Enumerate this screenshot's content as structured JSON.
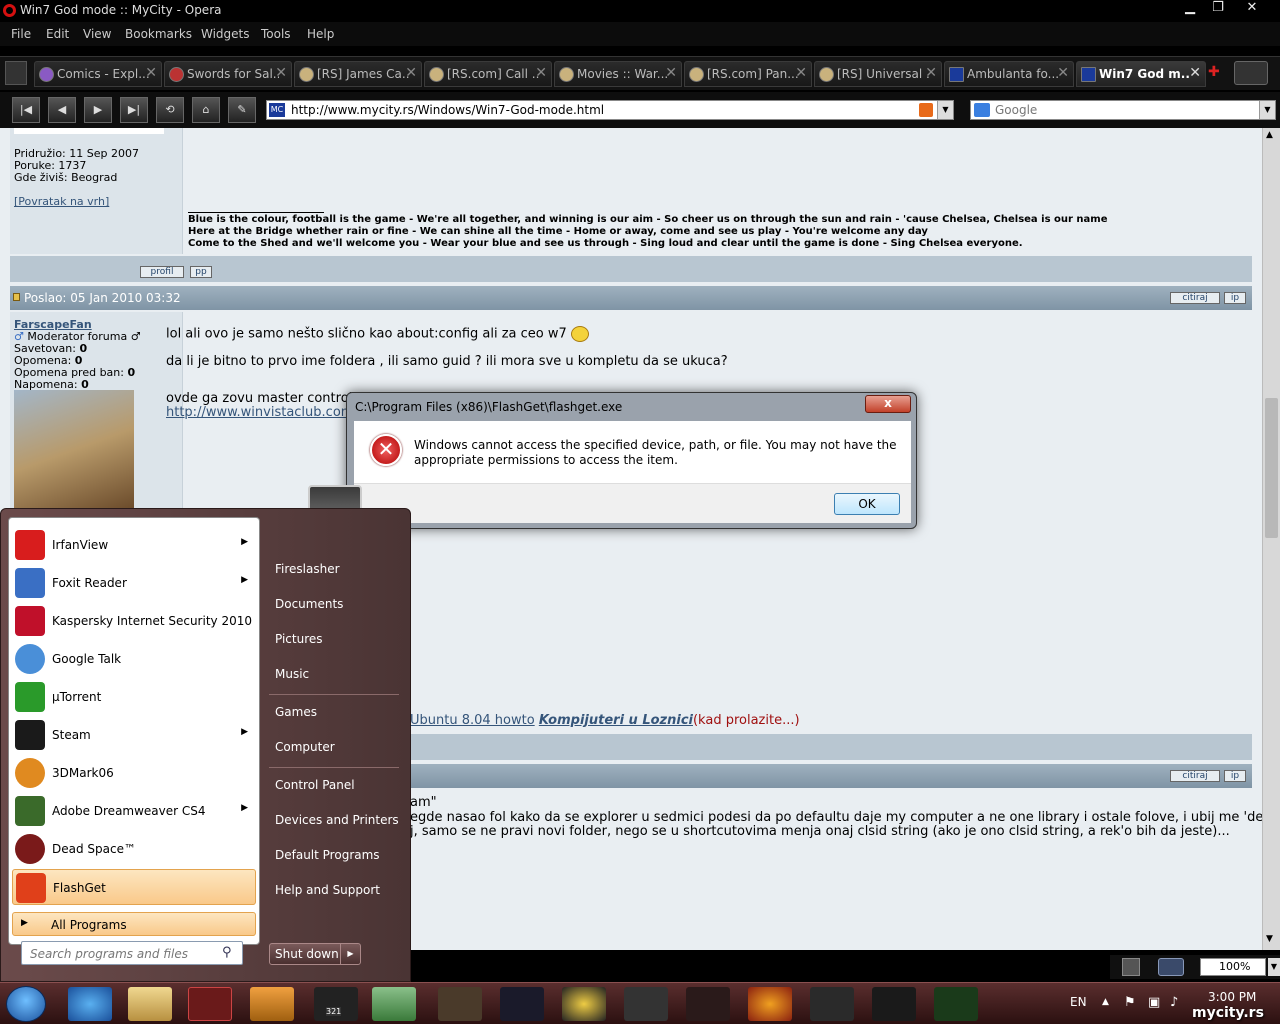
{
  "window": {
    "title": "Win7 God mode :: MyCity - Opera",
    "min": "▁",
    "max": "❐",
    "close": "✕"
  },
  "menu": [
    "File",
    "Edit",
    "View",
    "Bookmarks",
    "Widgets",
    "Tools",
    "Help"
  ],
  "tabs": [
    {
      "label": "Comics - Expl..."
    },
    {
      "label": "Swords for Sal..."
    },
    {
      "label": "[RS] James Ca..."
    },
    {
      "label": "[RS.com] Call ..."
    },
    {
      "label": "Movies :: War..."
    },
    {
      "label": "[RS.com] Pan..."
    },
    {
      "label": "[RS] Universal ..."
    },
    {
      "label": "Ambulanta fo..."
    },
    {
      "label": "Win7 God m..."
    }
  ],
  "nav": {
    "url": "http://www.mycity.rs/Windows/Win7-God-mode.html",
    "search_placeholder": "Google",
    "favicon": "MC"
  },
  "post1": {
    "joined": "Pridružio: 11 Sep 2007",
    "posts": "Poruke: 1737",
    "location": "Gde živiš: Beograd",
    "back_top": "[Povratak na vrh]",
    "sig": [
      "Blue is the colour, football is the game - We're all together, and winning is our aim - So cheer us on through the sun and rain - 'cause Chelsea, Chelsea is our name",
      "Here at the Bridge whether rain or fine - We can shine all the time - Home or away, come and see us play - You're welcome any day",
      "Come to the Shed and we'll welcome you - Wear your blue and see us through - Sing loud and clear until the game is done - Sing Chelsea everyone."
    ],
    "profil": "profil",
    "pp": "pp"
  },
  "post2": {
    "header": "Poslao: 05 Jan 2010 03:32",
    "quote": "citiraj",
    "ip": "ip",
    "user": "FarscapeFan",
    "role": "Moderator foruma ♂",
    "stats": [
      {
        "label": "Savetovan:",
        "value": "0"
      },
      {
        "label": "Opomena:",
        "value": "0"
      },
      {
        "label": "Opomena pred ban:",
        "value": "0"
      },
      {
        "label": "Napomena:",
        "value": "0"
      }
    ],
    "line1": "lol ali ovo je samo nešto slično kao about:config ali za ceo w7",
    "line2": "da li je bitno to prvo ime foldera , ili samo guid ? ili mora sve u kompletu da se ukuca?",
    "line3": "ovde ga zovu master control",
    "link": "http://www.winvistaclub.com",
    "sig_link1": "Ubuntu 8.04 howto",
    "sig_link2": "Kompijuteri u Loznici",
    "sig_tail": "(kad prolazite...)"
  },
  "post3": {
    "quote": "citiraj",
    "ip": "ip",
    "q_tail": "am\"",
    "l1": "egde nasao fol kako da se explorer u sedmici podesi da po defaultu daje my computer a ne one library i ostale folove, i ubij me 'de je",
    "l2": "j, samo se ne pravi novi folder, nego se u shortcutovima menja onaj clsid string (ako je ono clsid string, a rek'o bih da jeste)..."
  },
  "dialog": {
    "title": "C:\\Program Files (x86)\\FlashGet\\flashget.exe",
    "close": "x",
    "message": "Windows cannot access the specified device, path, or file.  You may not have the appropriate permissions to access the item.",
    "ok": "OK",
    "icon": "error-icon"
  },
  "startmenu": {
    "programs": [
      {
        "label": "IrfanView",
        "arrow": "▶",
        "color": "#d81d1d"
      },
      {
        "label": "Foxit Reader",
        "arrow": "▶",
        "color": "#3a6fc4"
      },
      {
        "label": "Kaspersky Internet Security 2010",
        "arrow": "",
        "color": "#c0102a"
      },
      {
        "label": "Google Talk",
        "arrow": "",
        "color": "#4a8fd8"
      },
      {
        "label": "µTorrent",
        "arrow": "",
        "color": "#2a9a2a"
      },
      {
        "label": "Steam",
        "arrow": "▶",
        "color": "#1a1a1a"
      },
      {
        "label": "3DMark06",
        "arrow": "",
        "color": "#e08a20"
      },
      {
        "label": "Adobe Dreamweaver CS4",
        "arrow": "▶",
        "color": "#3a6a2a"
      },
      {
        "label": "Dead Space™",
        "arrow": "",
        "color": "#7a1a1a"
      },
      {
        "label": "FlashGet",
        "arrow": "",
        "color": "#e0401a"
      }
    ],
    "all_programs": "All Programs",
    "search_placeholder": "Search programs and files",
    "right": [
      "Fireslasher",
      "Documents",
      "Pictures",
      "Music",
      "Games",
      "Computer",
      "Control Panel",
      "Devices and Printers",
      "Default Programs",
      "Help and Support"
    ],
    "shutdown": "Shut down"
  },
  "statusbar": {
    "zoom": "100%"
  },
  "taskbar": {
    "lang": "EN",
    "clock": "3:00 PM",
    "watermark": "mycity.rs",
    "badge": "321"
  }
}
